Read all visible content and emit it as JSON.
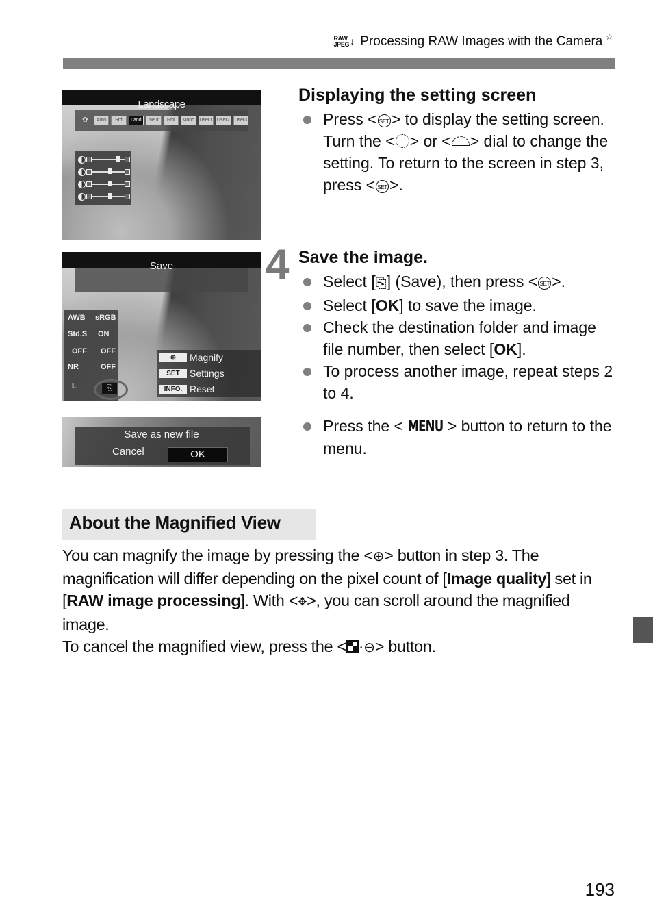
{
  "header": {
    "raw_icon_top": "RAW",
    "raw_icon_bottom": "JPEG",
    "raw_icon_arrow": "↓",
    "title": "Processing RAW Images with the Camera",
    "star": "☆"
  },
  "screens": {
    "setting_screen": {
      "title": "Landscape",
      "style_chips": [
        "Auto",
        "Std",
        "Ptrt",
        "Land",
        "Neut",
        "Fthl",
        "Mono",
        "User1",
        "User2",
        "User3"
      ],
      "selected_chip_index": 3,
      "params": [
        {
          "name": "Sharpness",
          "level": 0.7
        },
        {
          "name": "Contrast",
          "level": 0.5
        },
        {
          "name": "Saturation",
          "level": 0.5
        },
        {
          "name": "Color tone",
          "level": 0.5
        }
      ]
    },
    "save_screen": {
      "title": "Save",
      "left_items": [
        "AWB",
        "sRGB",
        "Std.S",
        "ON",
        "OFF",
        "OFF",
        "NR",
        "OFF",
        "L",
        "Save"
      ],
      "menu": [
        {
          "key": "⊕",
          "label": "Magnify"
        },
        {
          "key": "SET",
          "label": "Settings"
        },
        {
          "key": "INFO.",
          "label": "Reset"
        }
      ]
    },
    "confirm_screen": {
      "title": "Save as new file",
      "cancel": "Cancel",
      "ok": "OK"
    }
  },
  "section_display": {
    "heading": "Displaying the setting screen",
    "bullet": {
      "t1": "Press <",
      "set1": "SET",
      "t2": "> to display the setting screen. Turn the <",
      "t3": "> or <",
      "t4": "> dial to change the setting. To return to the screen in step 3, press <",
      "set2": "SET",
      "t5": ">."
    }
  },
  "step4": {
    "number": "4",
    "heading": "Save the image.",
    "b1": {
      "t1": "Select [",
      "icon": "⎘",
      "t2": "] (Save), then press <",
      "set": "SET",
      "t3": ">."
    },
    "b2": {
      "t1": "Select [",
      "bold": "OK",
      "t2": "] to save the image."
    },
    "b3": {
      "t1": "Check the destination folder and image file number, then select [",
      "bold": "OK",
      "t2": "]."
    },
    "b4": "To process another image, repeat steps 2 to 4."
  },
  "section_menu": {
    "t1": "Press the <",
    "menu": "MENU",
    "t2": "> button to return to the menu."
  },
  "magnified": {
    "heading": "About the Magnified View",
    "p1": "You can magnify the image by pressing the <",
    "zoom_in": "⊕",
    "p2": "> button in step 3. The magnification will differ depending on the pixel count of [",
    "b1": "Image quality",
    "p3": "] set in [",
    "b2": "RAW image processing",
    "p4": "]. With <",
    "cross": "✥",
    "p5": ">, you can scroll around the magnified image.",
    "p6": "To cancel the magnified view, press the <",
    "dot": "·",
    "zoom_out": "⊖",
    "p7": "> button."
  },
  "page_number": "193"
}
